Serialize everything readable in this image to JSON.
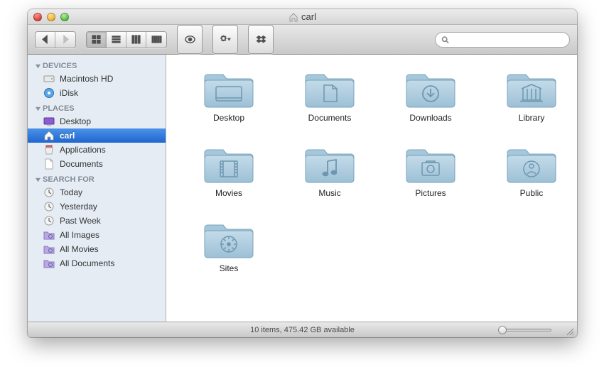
{
  "window": {
    "title": "carl"
  },
  "sidebar": {
    "sections": [
      {
        "header": "DEVICES",
        "items": [
          {
            "icon": "hdd",
            "label": "Macintosh HD"
          },
          {
            "icon": "idisk",
            "label": "iDisk"
          }
        ]
      },
      {
        "header": "PLACES",
        "items": [
          {
            "icon": "desktop",
            "label": "Desktop"
          },
          {
            "icon": "home",
            "label": "carl",
            "selected": true
          },
          {
            "icon": "app",
            "label": "Applications"
          },
          {
            "icon": "doc",
            "label": "Documents"
          }
        ]
      },
      {
        "header": "SEARCH FOR",
        "items": [
          {
            "icon": "clock",
            "label": "Today"
          },
          {
            "icon": "clock",
            "label": "Yesterday"
          },
          {
            "icon": "clock",
            "label": "Past Week"
          },
          {
            "icon": "smart",
            "label": "All Images"
          },
          {
            "icon": "smart",
            "label": "All Movies"
          },
          {
            "icon": "smart",
            "label": "All Documents"
          }
        ]
      }
    ]
  },
  "folders": [
    {
      "label": "Desktop",
      "glyph": "desktop"
    },
    {
      "label": "Documents",
      "glyph": "documents"
    },
    {
      "label": "Downloads",
      "glyph": "downloads"
    },
    {
      "label": "Library",
      "glyph": "library"
    },
    {
      "label": "Movies",
      "glyph": "movies"
    },
    {
      "label": "Music",
      "glyph": "music"
    },
    {
      "label": "Pictures",
      "glyph": "pictures"
    },
    {
      "label": "Public",
      "glyph": "public"
    },
    {
      "label": "Sites",
      "glyph": "sites"
    }
  ],
  "status": {
    "text": "10 items, 475.42 GB available"
  },
  "search": {
    "placeholder": ""
  }
}
